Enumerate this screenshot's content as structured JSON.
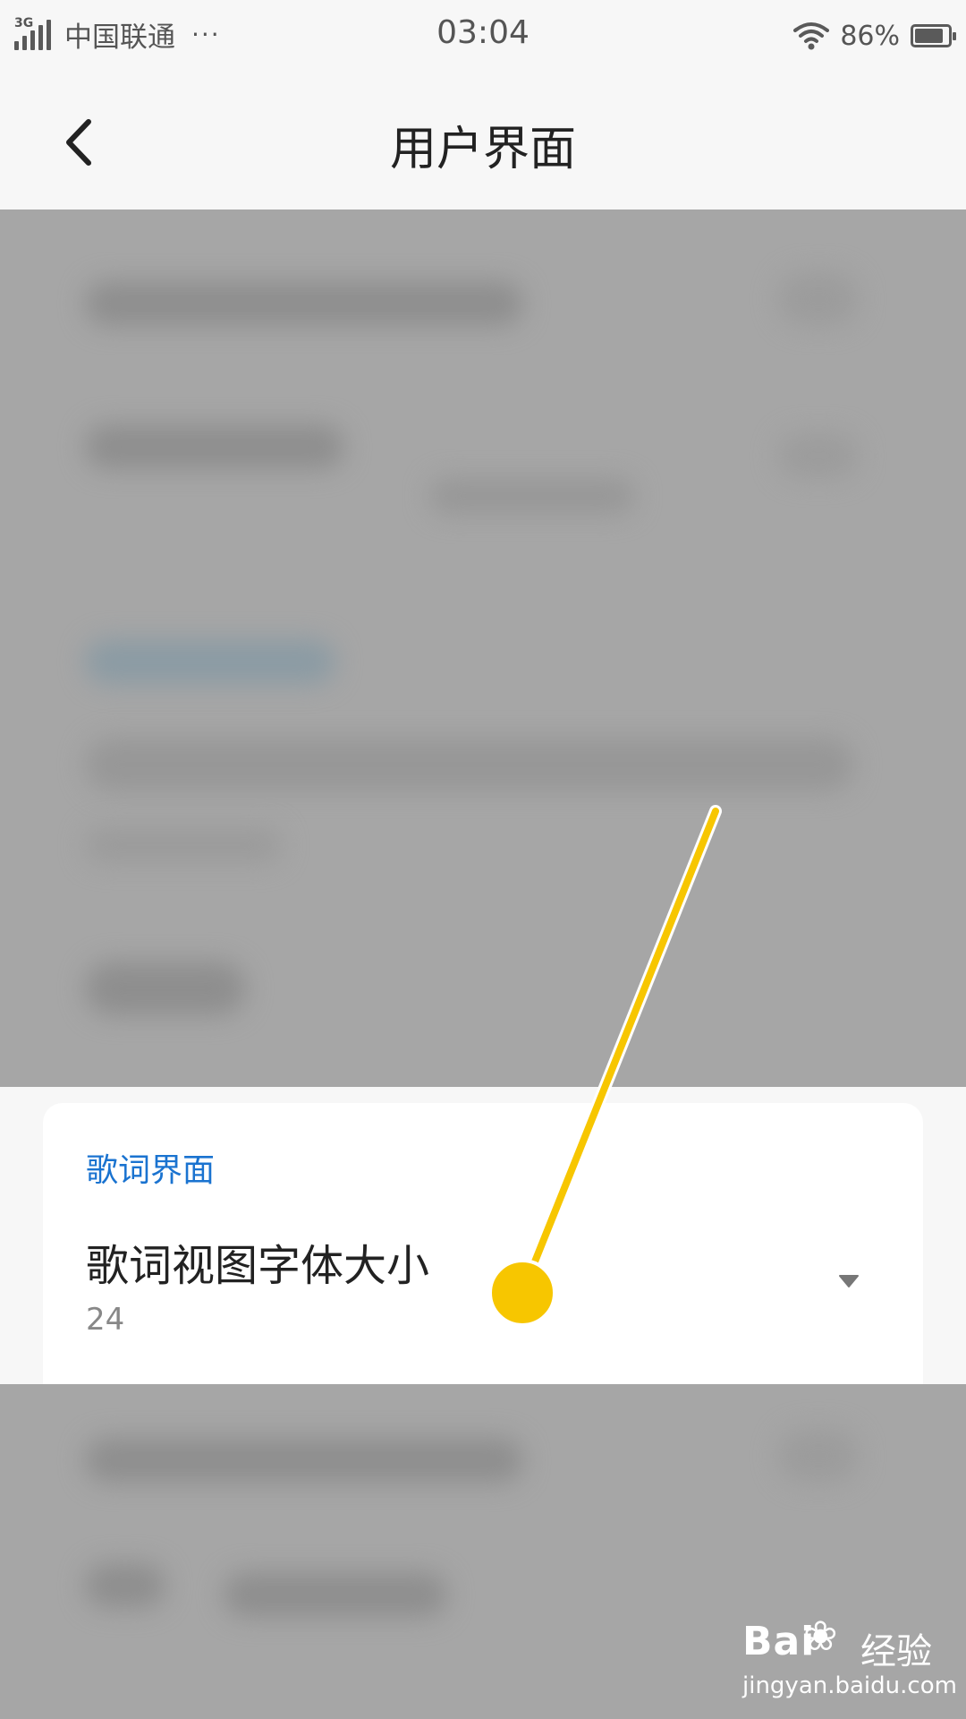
{
  "status_bar": {
    "network_type": "3G",
    "carrier": "中国联通",
    "more": "···",
    "time": "03:04",
    "battery_percent": "86%",
    "battery_level": 0.86,
    "icons": [
      "signal-icon",
      "wifi-icon",
      "battery-icon"
    ]
  },
  "header": {
    "title": "用户界面",
    "back_icon": "chevron-left-icon"
  },
  "card": {
    "section_title": "歌词界面",
    "preference": {
      "title": "歌词视图字体大小",
      "value": "24",
      "icon": "dropdown-arrow-icon"
    }
  },
  "watermark": {
    "brand": "Bai",
    "brand_cn": "经验",
    "url": "jingyan.baidu.com"
  },
  "colors": {
    "accent": "#1a73d0",
    "pointer": "#f7c600",
    "overlay": "#a6a6a6"
  }
}
